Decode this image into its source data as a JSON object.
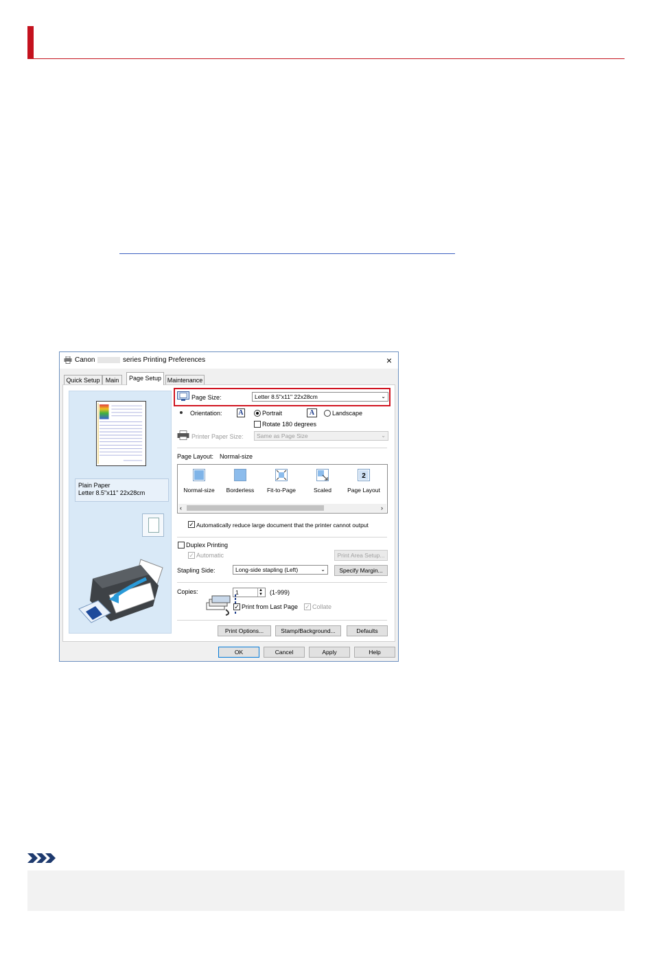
{
  "dialog": {
    "title_prefix": "Canon",
    "title_suffix": "series Printing Preferences",
    "close": "×",
    "tabs": [
      {
        "label": "Quick Setup"
      },
      {
        "label": "Main"
      },
      {
        "label": "Page Setup",
        "active": true
      },
      {
        "label": "Maintenance"
      }
    ],
    "preview": {
      "media_type": "Plain Paper",
      "media_size": "Letter 8.5\"x11\" 22x28cm"
    },
    "page_size": {
      "label": "Page Size:",
      "value": "Letter 8.5\"x11\" 22x28cm"
    },
    "orientation": {
      "label": "Orientation:",
      "glyph": "A",
      "portrait": "Portrait",
      "landscape": "Landscape",
      "selected": "Portrait",
      "rotate": "Rotate 180 degrees"
    },
    "printer_paper_size": {
      "label": "Printer Paper Size:",
      "value": "Same as Page Size"
    },
    "page_layout": {
      "label": "Page Layout:",
      "value": "Normal-size",
      "items": [
        {
          "label": "Normal-size"
        },
        {
          "label": "Borderless"
        },
        {
          "label": "Fit-to-Page"
        },
        {
          "label": "Scaled"
        },
        {
          "label": "Page Layout"
        }
      ],
      "scroll_left": "‹",
      "scroll_right": "›"
    },
    "auto_reduce": "Automatically reduce large document that the printer cannot output",
    "duplex": {
      "label": "Duplex Printing",
      "automatic": "Automatic",
      "print_area_setup": "Print Area Setup..."
    },
    "stapling": {
      "label": "Stapling Side:",
      "value": "Long-side stapling (Left)",
      "specify_margin": "Specify Margin..."
    },
    "copies": {
      "label": "Copies:",
      "value": "1",
      "range": "(1-999)",
      "print_from_last": "Print from Last Page",
      "collate": "Collate"
    },
    "buttons": {
      "print_options": "Print Options...",
      "stamp_background": "Stamp/Background...",
      "defaults": "Defaults",
      "ok": "OK",
      "cancel": "Cancel",
      "apply": "Apply",
      "help": "Help"
    }
  },
  "colors": {
    "accent_red": "#c4121e",
    "highlight": "#d0121e",
    "link_blue": "#3b5fc0",
    "preview_bg": "#d9e9f7"
  }
}
